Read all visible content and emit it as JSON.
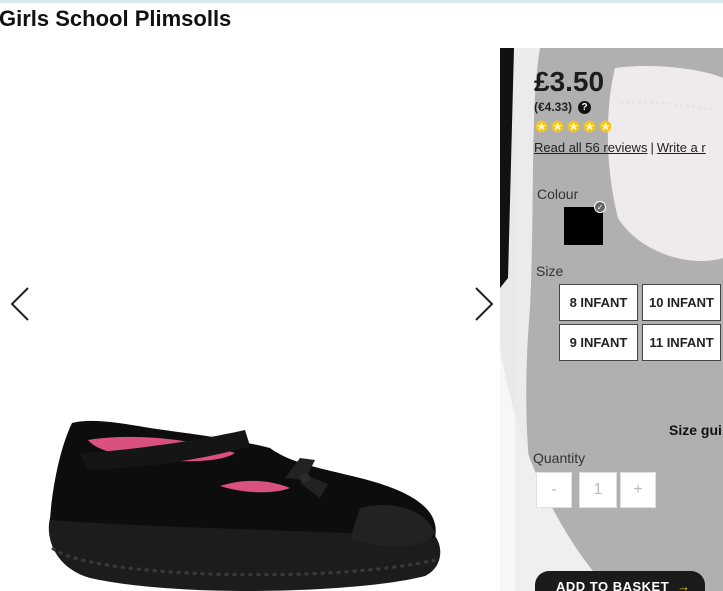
{
  "title": "Girls School Plimsolls",
  "product": {
    "price": "£3.50",
    "price_euro": "(€4.33)",
    "help_icon": "?",
    "rating_stars": 5,
    "read_reviews": "Read all 56 reviews",
    "separator": "|",
    "write_review": "Write a r"
  },
  "colour": {
    "label": "Colour",
    "selected": "#000000"
  },
  "size": {
    "label": "Size",
    "options": [
      "8 INFANT",
      "10 INFANT",
      "9 INFANT",
      "11 INFANT"
    ],
    "guide": "Size gui"
  },
  "quantity": {
    "label": "Quantity",
    "minus": "-",
    "value": "1",
    "plus": "+"
  },
  "basket": {
    "label": "ADD TO BASKET",
    "arrow": "→"
  },
  "colors": {
    "star": "#f5c518",
    "button": "#1b1b1b",
    "accent": "#f0c419"
  }
}
